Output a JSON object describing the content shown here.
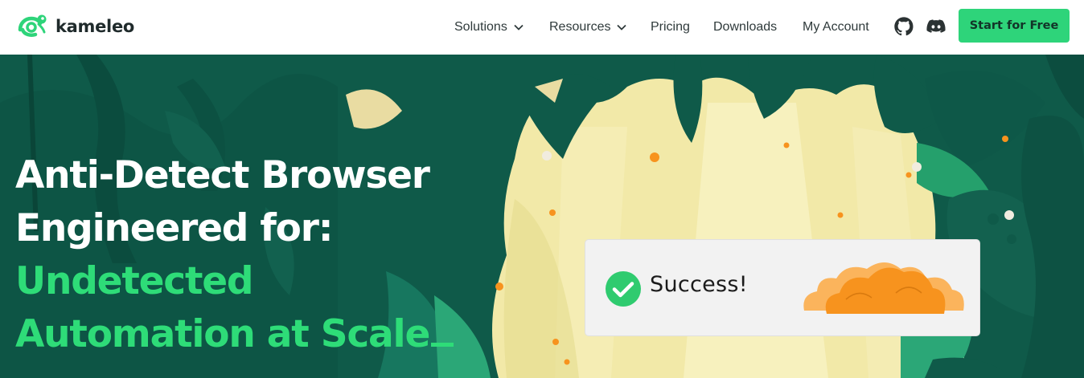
{
  "brand": {
    "name": "kameleo"
  },
  "nav": {
    "items": [
      {
        "label": "Solutions",
        "has_dropdown": true
      },
      {
        "label": "Resources",
        "has_dropdown": true
      },
      {
        "label": "Pricing",
        "has_dropdown": false
      },
      {
        "label": "Downloads",
        "has_dropdown": false
      },
      {
        "label": "My Account",
        "has_dropdown": false
      }
    ],
    "icons": [
      "github-icon",
      "discord-icon"
    ],
    "cta_label": "Start for Free"
  },
  "hero": {
    "headline_line1": "Anti-Detect Browser",
    "headline_line2": "Engineered for:",
    "headline_green1": "Undetected",
    "headline_green2": "Automation at Scale",
    "success_text": "Success!"
  },
  "colors": {
    "accent": "#2ed47a",
    "hero_bg": "#0f5a49",
    "headline_green": "#2edc78",
    "cloud_orange": "#f7931e"
  }
}
